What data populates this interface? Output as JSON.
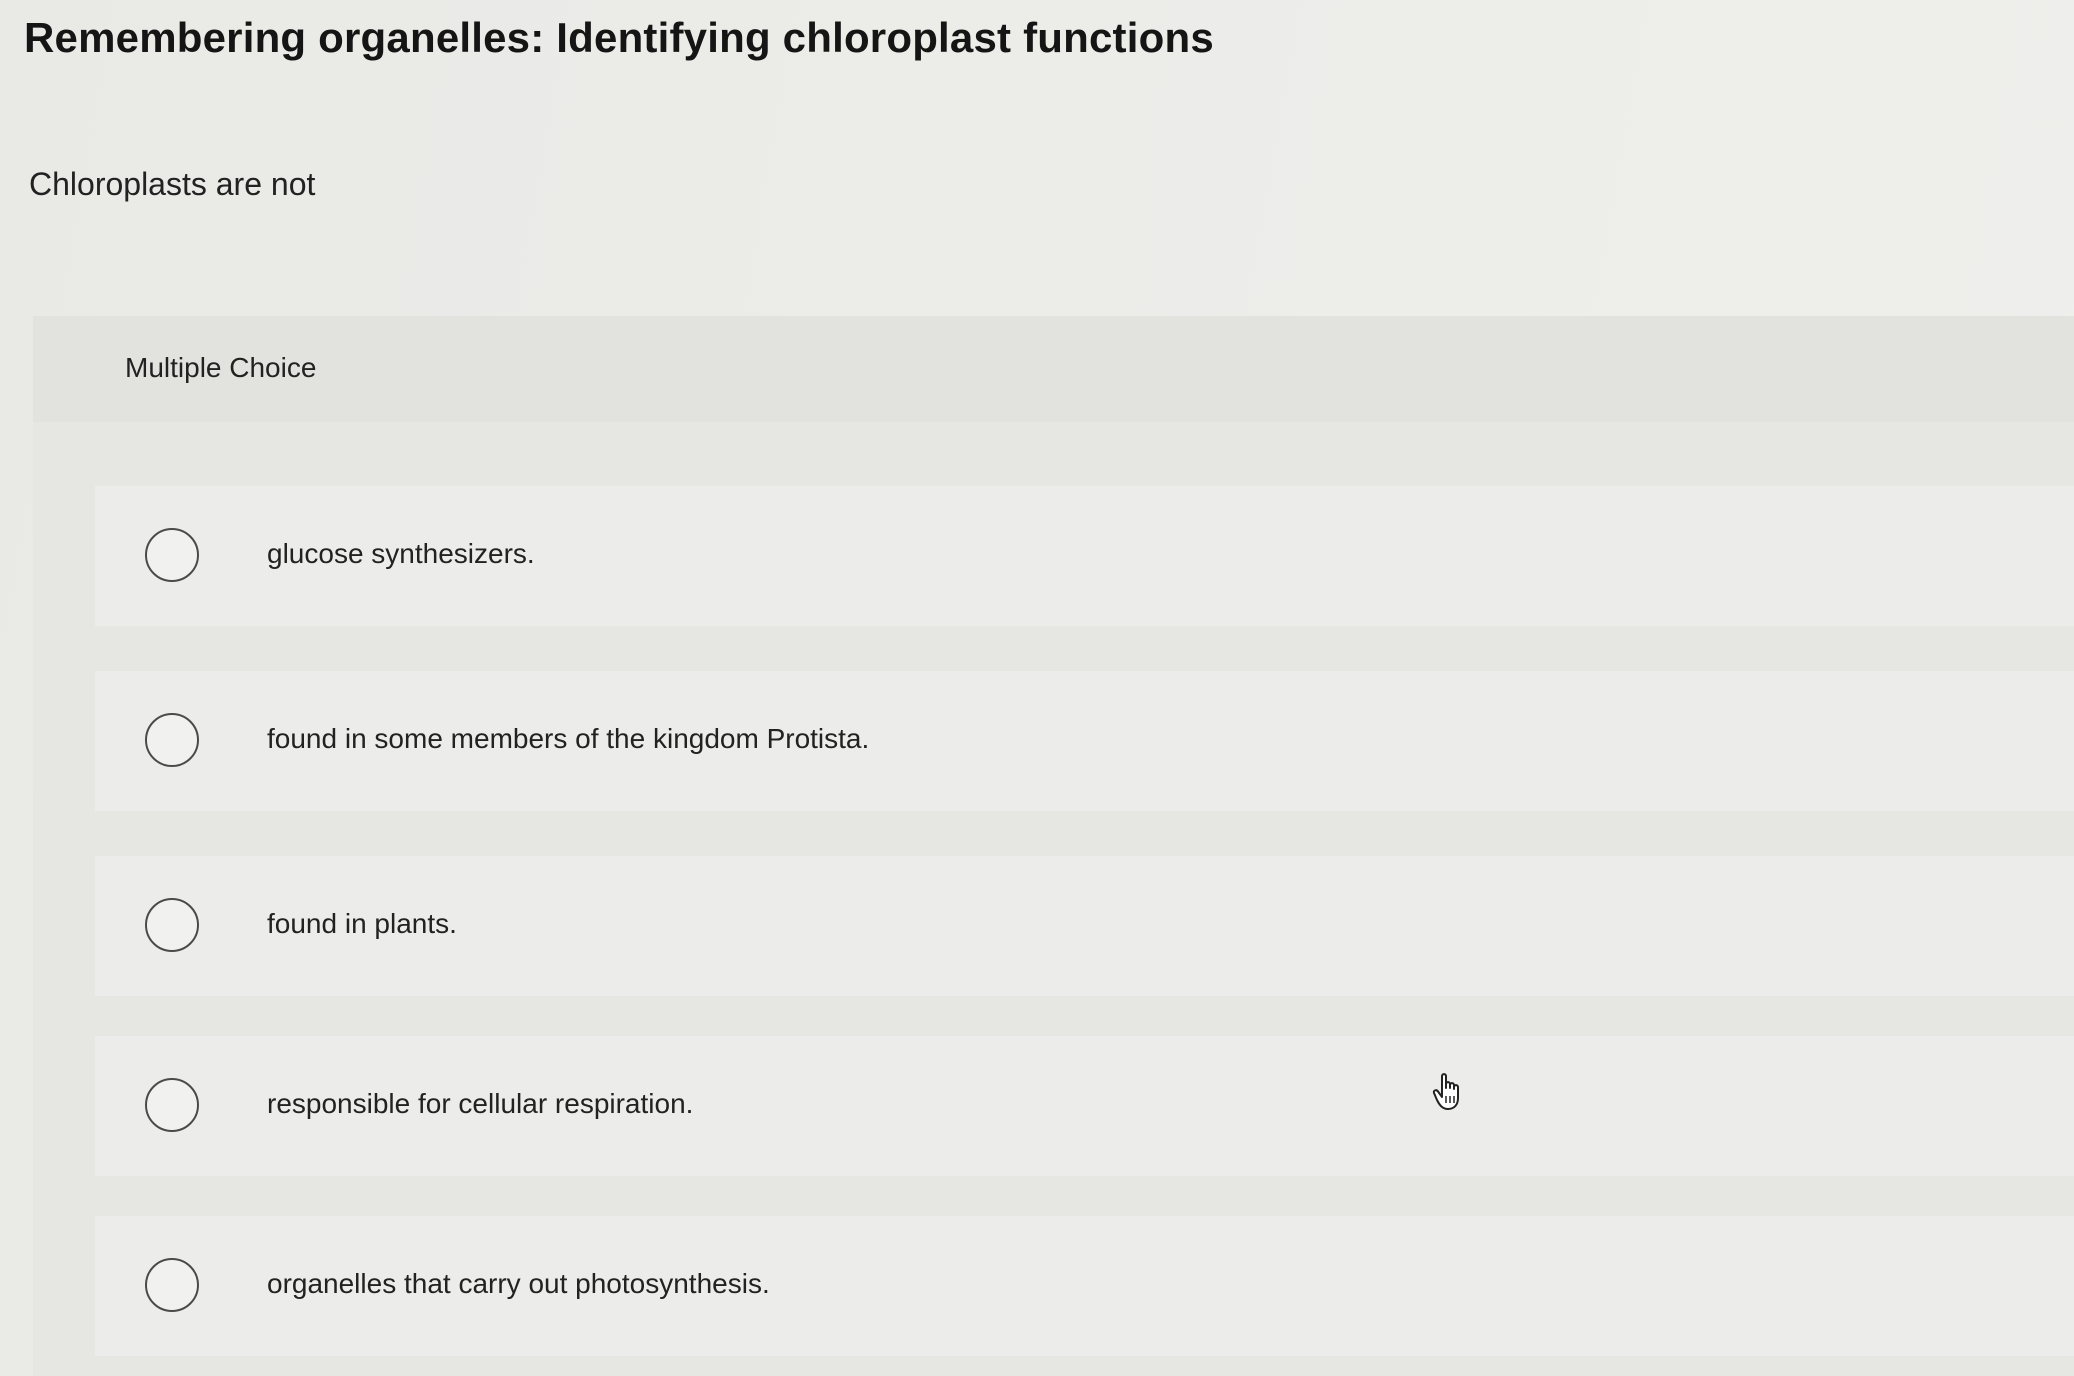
{
  "page": {
    "title": "Remembering organelles: Identifying chloroplast functions"
  },
  "question": {
    "prompt": "Chloroplasts are not",
    "type_label": "Multiple Choice",
    "options": [
      {
        "label": "glucose synthesizers.",
        "selected": false
      },
      {
        "label": "found in some members of the kingdom Protista.",
        "selected": false
      },
      {
        "label": "found in plants.",
        "selected": false
      },
      {
        "label": "responsible for cellular respiration.",
        "selected": false
      },
      {
        "label": "organelles that carry out photosynthesis.",
        "selected": false
      }
    ]
  },
  "cursor": {
    "icon": "pointer-hand-icon"
  }
}
